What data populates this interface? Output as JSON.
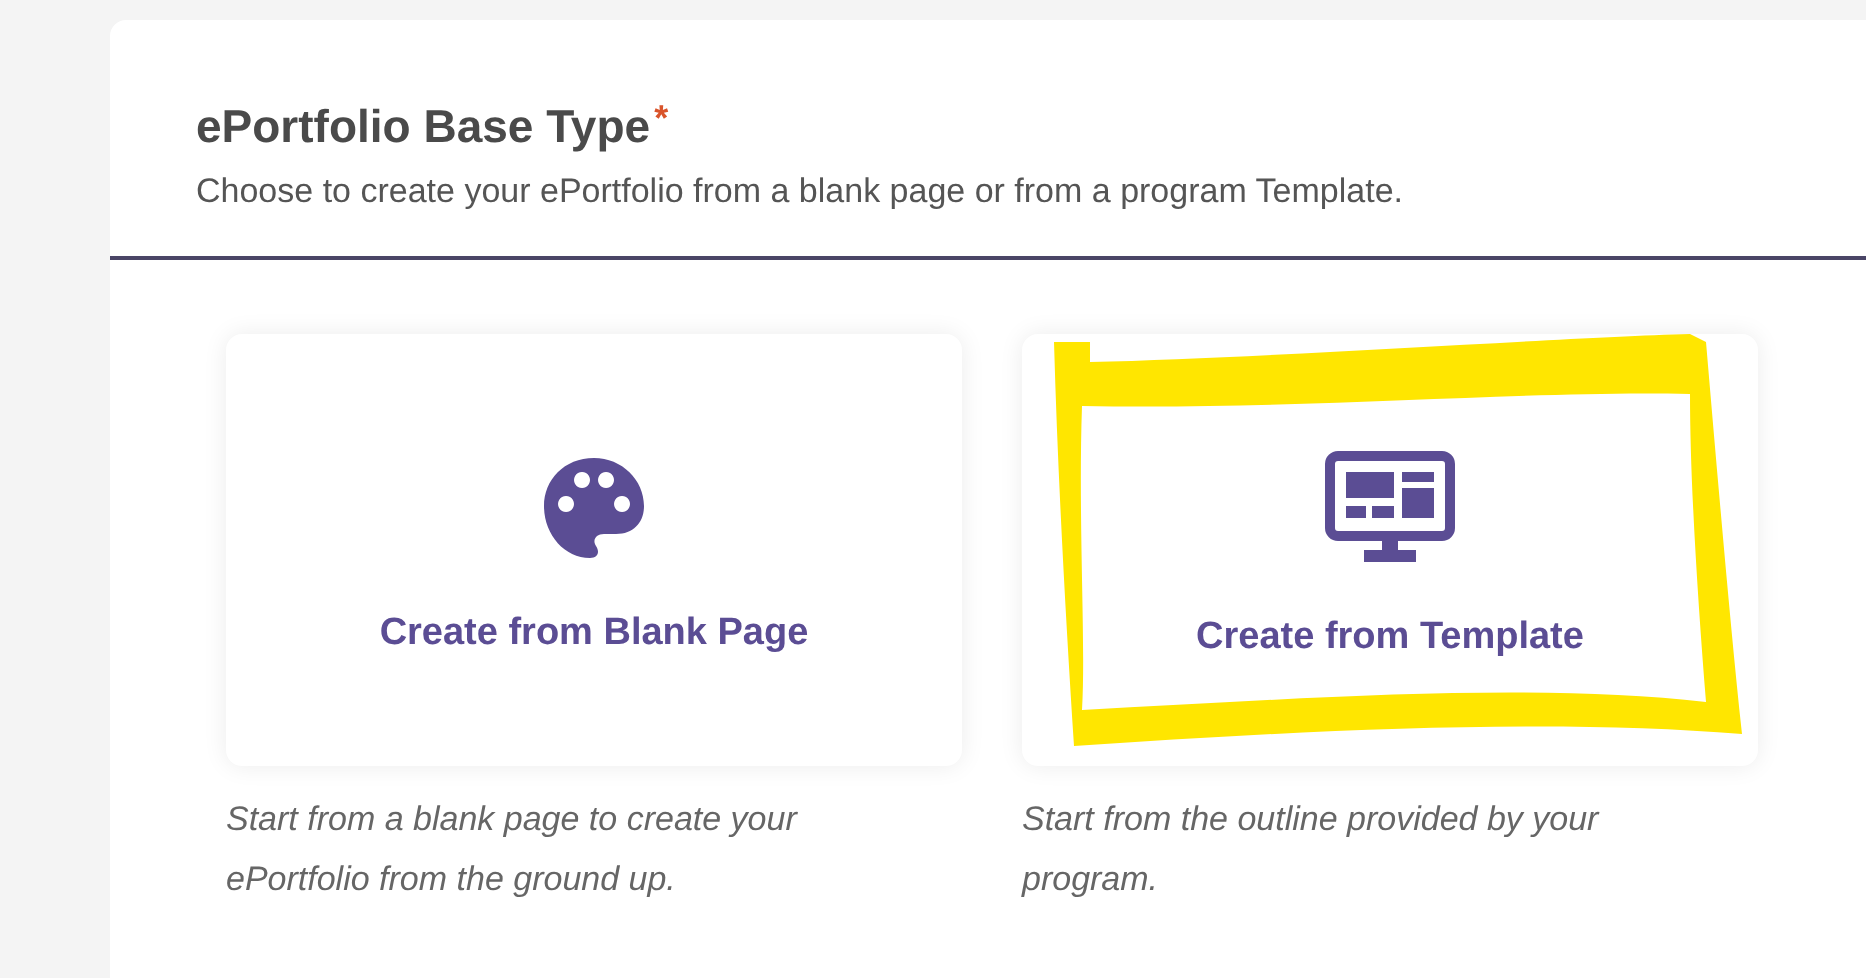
{
  "section": {
    "title": "ePortfolio Base Type",
    "required_mark": "*",
    "description": "Choose to create your ePortfolio from a blank page or from a program Template."
  },
  "options": [
    {
      "kind": "palette",
      "label": "Create from Blank Page",
      "caption": "Start from a blank page to create your ePortfolio from the ground up.",
      "highlighted": false
    },
    {
      "kind": "monitor",
      "label": "Create from Template",
      "caption": "Start from the outline provided by your program.",
      "highlighted": true
    }
  ]
}
